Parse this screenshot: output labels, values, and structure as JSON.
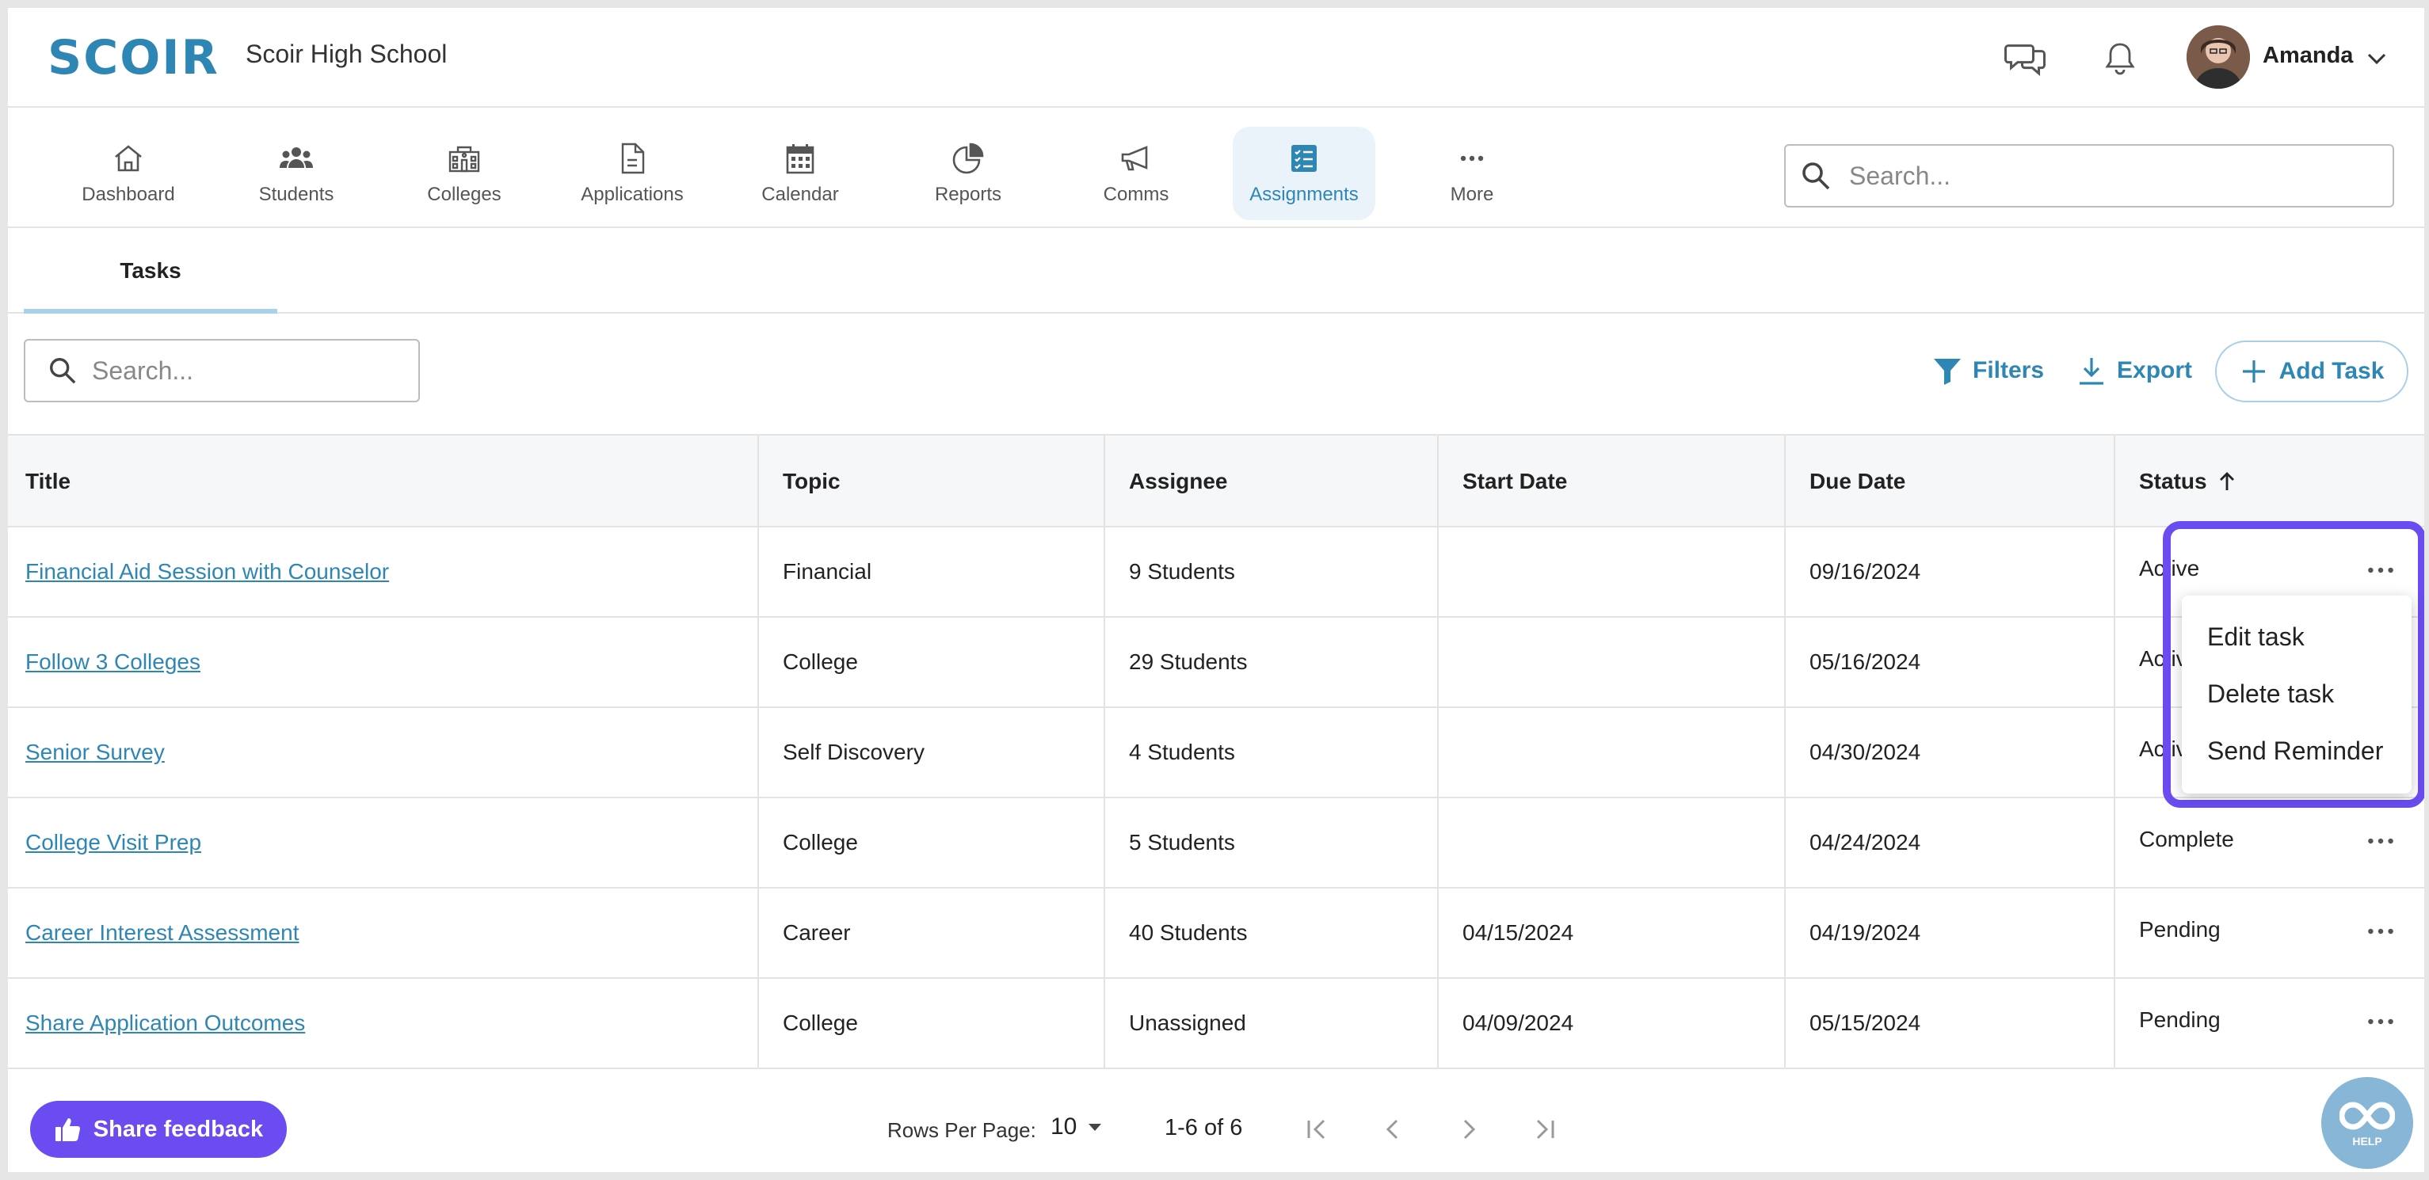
{
  "header": {
    "logo_text": "SCOIR",
    "school_name": "Scoir High School",
    "user_name": "Amanda",
    "icons": [
      "chat-icon",
      "bell-icon",
      "chevron-down-icon"
    ],
    "brand_color": "#2e86b5"
  },
  "nav": {
    "items": [
      {
        "label": "Dashboard",
        "icon": "home-icon"
      },
      {
        "label": "Students",
        "icon": "students-icon"
      },
      {
        "label": "Colleges",
        "icon": "college-icon"
      },
      {
        "label": "Applications",
        "icon": "document-icon"
      },
      {
        "label": "Calendar",
        "icon": "calendar-icon"
      },
      {
        "label": "Reports",
        "icon": "pie-chart-icon"
      },
      {
        "label": "Comms",
        "icon": "megaphone-icon"
      },
      {
        "label": "Assignments",
        "icon": "checklist-icon",
        "active": true
      },
      {
        "label": "More",
        "icon": "more-icon"
      }
    ],
    "search_placeholder": "Search..."
  },
  "tabs": {
    "items": [
      {
        "label": "Tasks",
        "active": true
      }
    ]
  },
  "toolbar": {
    "search_placeholder": "Search...",
    "filters_label": "Filters",
    "export_label": "Export",
    "add_task_label": "Add Task"
  },
  "table": {
    "columns": [
      "Title",
      "Topic",
      "Assignee",
      "Start Date",
      "Due Date",
      "Status"
    ],
    "sort": {
      "column": "Status",
      "direction": "ascending"
    },
    "rows": [
      {
        "title": "Financial Aid Session with Counselor",
        "topic": "Financial",
        "assignee": "9 Students",
        "start": "",
        "due": "09/16/2024",
        "status": "Active"
      },
      {
        "title": "Follow 3 Colleges",
        "topic": "College",
        "assignee": "29 Students",
        "start": "",
        "due": "05/16/2024",
        "status": "Active"
      },
      {
        "title": "Senior Survey",
        "topic": "Self Discovery",
        "assignee": "4 Students",
        "start": "",
        "due": "04/30/2024",
        "status": "Active"
      },
      {
        "title": "College Visit Prep",
        "topic": "College",
        "assignee": "5 Students",
        "start": "",
        "due": "04/24/2024",
        "status": "Complete"
      },
      {
        "title": "Career Interest Assessment",
        "topic": "Career",
        "assignee": "40 Students",
        "start": "04/15/2024",
        "due": "04/19/2024",
        "status": "Pending"
      },
      {
        "title": "Share Application Outcomes",
        "topic": "College",
        "assignee": "Unassigned",
        "start": "04/09/2024",
        "due": "05/15/2024",
        "status": "Pending"
      }
    ]
  },
  "row_menu": {
    "items": [
      "Edit task",
      "Delete task",
      "Send Reminder"
    ],
    "highlight_color": "#6a4cf0"
  },
  "footer": {
    "feedback_label": "Share feedback",
    "rows_per_page_label": "Rows Per Page:",
    "rows_per_page_value": "10",
    "range_label": "1-6 of 6",
    "help_label": "HELP"
  }
}
